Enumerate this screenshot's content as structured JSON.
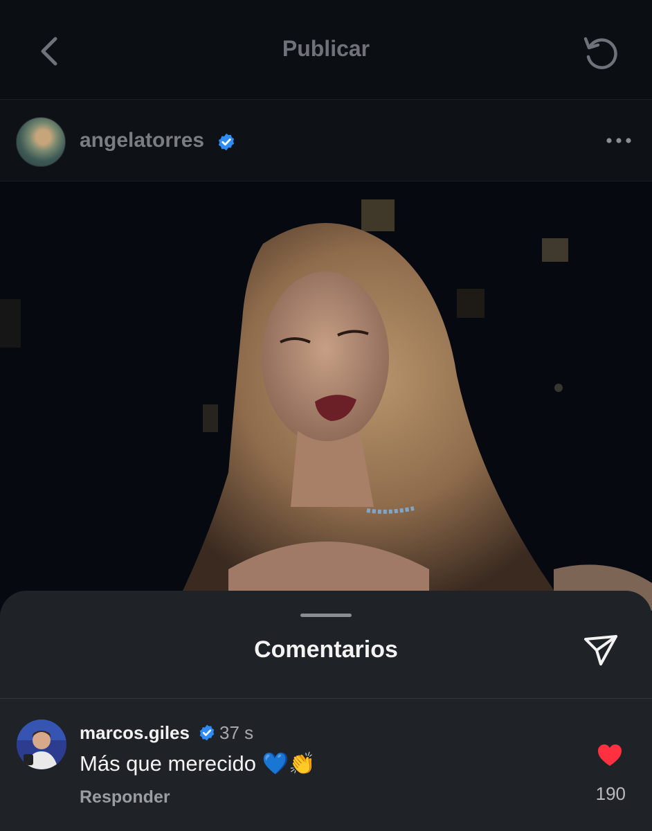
{
  "header": {
    "title": "Publicar",
    "back_icon": "chevron-left-icon",
    "refresh_icon": "refresh-icon"
  },
  "post": {
    "username": "angelatorres",
    "verified": true,
    "more_icon": "more-horizontal-icon"
  },
  "comments_sheet": {
    "title": "Comentarios",
    "share_icon": "send-icon",
    "comments": [
      {
        "username": "marcos.giles",
        "verified": true,
        "time": "37 s",
        "text": "Más que merecido 💙👏",
        "reply_label": "Responder",
        "likes": "190",
        "liked": true
      }
    ]
  },
  "colors": {
    "verified": "#2f8cf5",
    "heart": "#ff3040",
    "background": "#0d1015",
    "sheet": "#1f2227"
  }
}
